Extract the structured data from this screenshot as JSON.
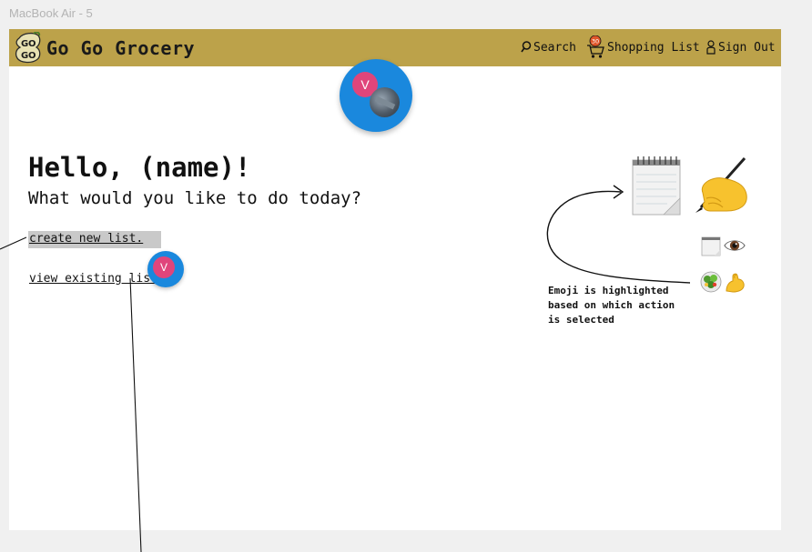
{
  "canvas": {
    "frame_label": "MacBook Air - 5"
  },
  "header": {
    "logo_text": "GO GO",
    "app_title": "Go Go Grocery",
    "nav": {
      "search": "Search",
      "shopping_list": "Shopping List",
      "shopping_list_badge": "30",
      "sign_out": "Sign Out"
    }
  },
  "collaborators": {
    "initial": "V"
  },
  "main": {
    "greeting": "Hello, (name)!",
    "subtitle": "What would you like to do today?",
    "options": {
      "create": "create new list.",
      "view": "view existing list"
    }
  },
  "sidebar": {
    "annotation": "Emoji is highlighted based on which action is selected",
    "icons": [
      "notepad-icon",
      "writing-hand-icon",
      "eye-icon",
      "salad-icon",
      "flexed-biceps-icon"
    ]
  },
  "colors": {
    "navbar": "#bca24a",
    "avatar": "#1a88dd",
    "badge": "#e0457b",
    "selected_option": "#c9c9c9"
  }
}
